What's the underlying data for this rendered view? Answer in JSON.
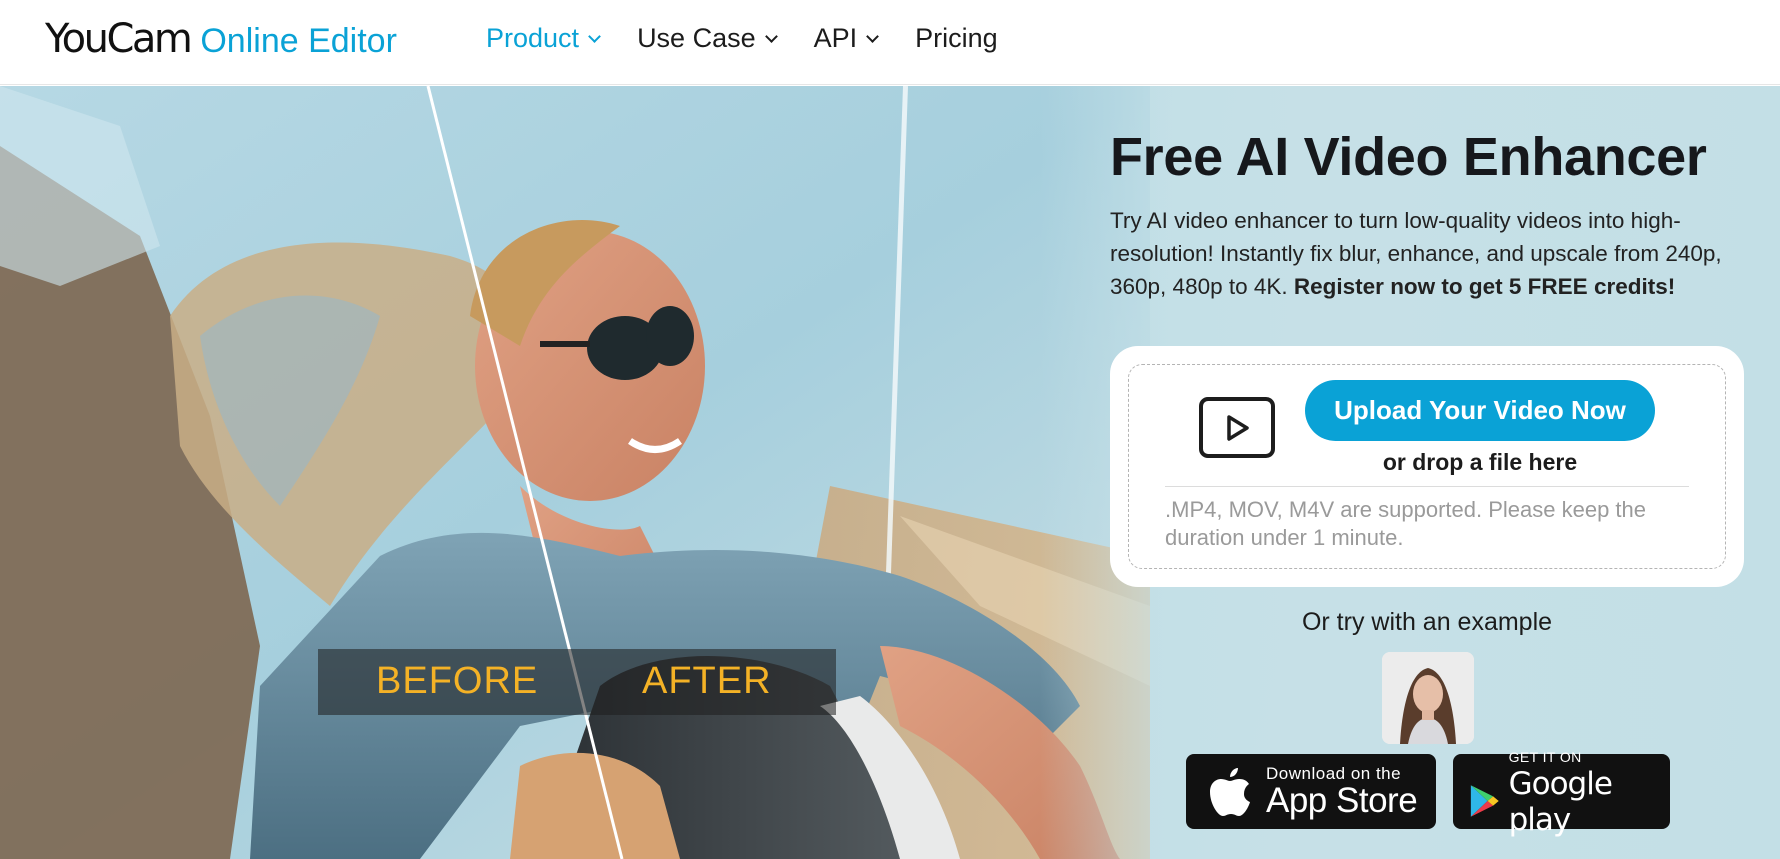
{
  "header": {
    "logo_main": "YouCam",
    "logo_sub": "Online Editor",
    "nav": [
      {
        "label": "Product",
        "has_dropdown": true,
        "active": true
      },
      {
        "label": "Use Case",
        "has_dropdown": true,
        "active": false
      },
      {
        "label": "API",
        "has_dropdown": true,
        "active": false
      },
      {
        "label": "Pricing",
        "has_dropdown": false,
        "active": false
      }
    ]
  },
  "hero": {
    "before_label": "BEFORE",
    "after_label": "AFTER",
    "title": "Free AI Video Enhancer",
    "description": " Try AI video enhancer to turn low-quality videos into high-resolution! Instantly fix blur, enhance, and upscale from 240p, 360p, 480p to 4K. ",
    "description_bold": "Register now to get 5 FREE credits!",
    "upload": {
      "button_label": "Upload Your Video Now",
      "drop_text": "or drop a file here",
      "support_text": ".MP4, MOV, M4V are supported. Please keep the duration under 1 minute.",
      "icon": "video-play-icon"
    },
    "try_example_label": "Or try with an example",
    "stores": {
      "appstore_small": "Download on the",
      "appstore_big": "App Store",
      "gplay_small": "GET IT ON",
      "gplay_big": "Google play"
    }
  },
  "colors": {
    "accent": "#0aa2d6",
    "before_after_text": "#f4b226",
    "title_text": "#16181c"
  }
}
